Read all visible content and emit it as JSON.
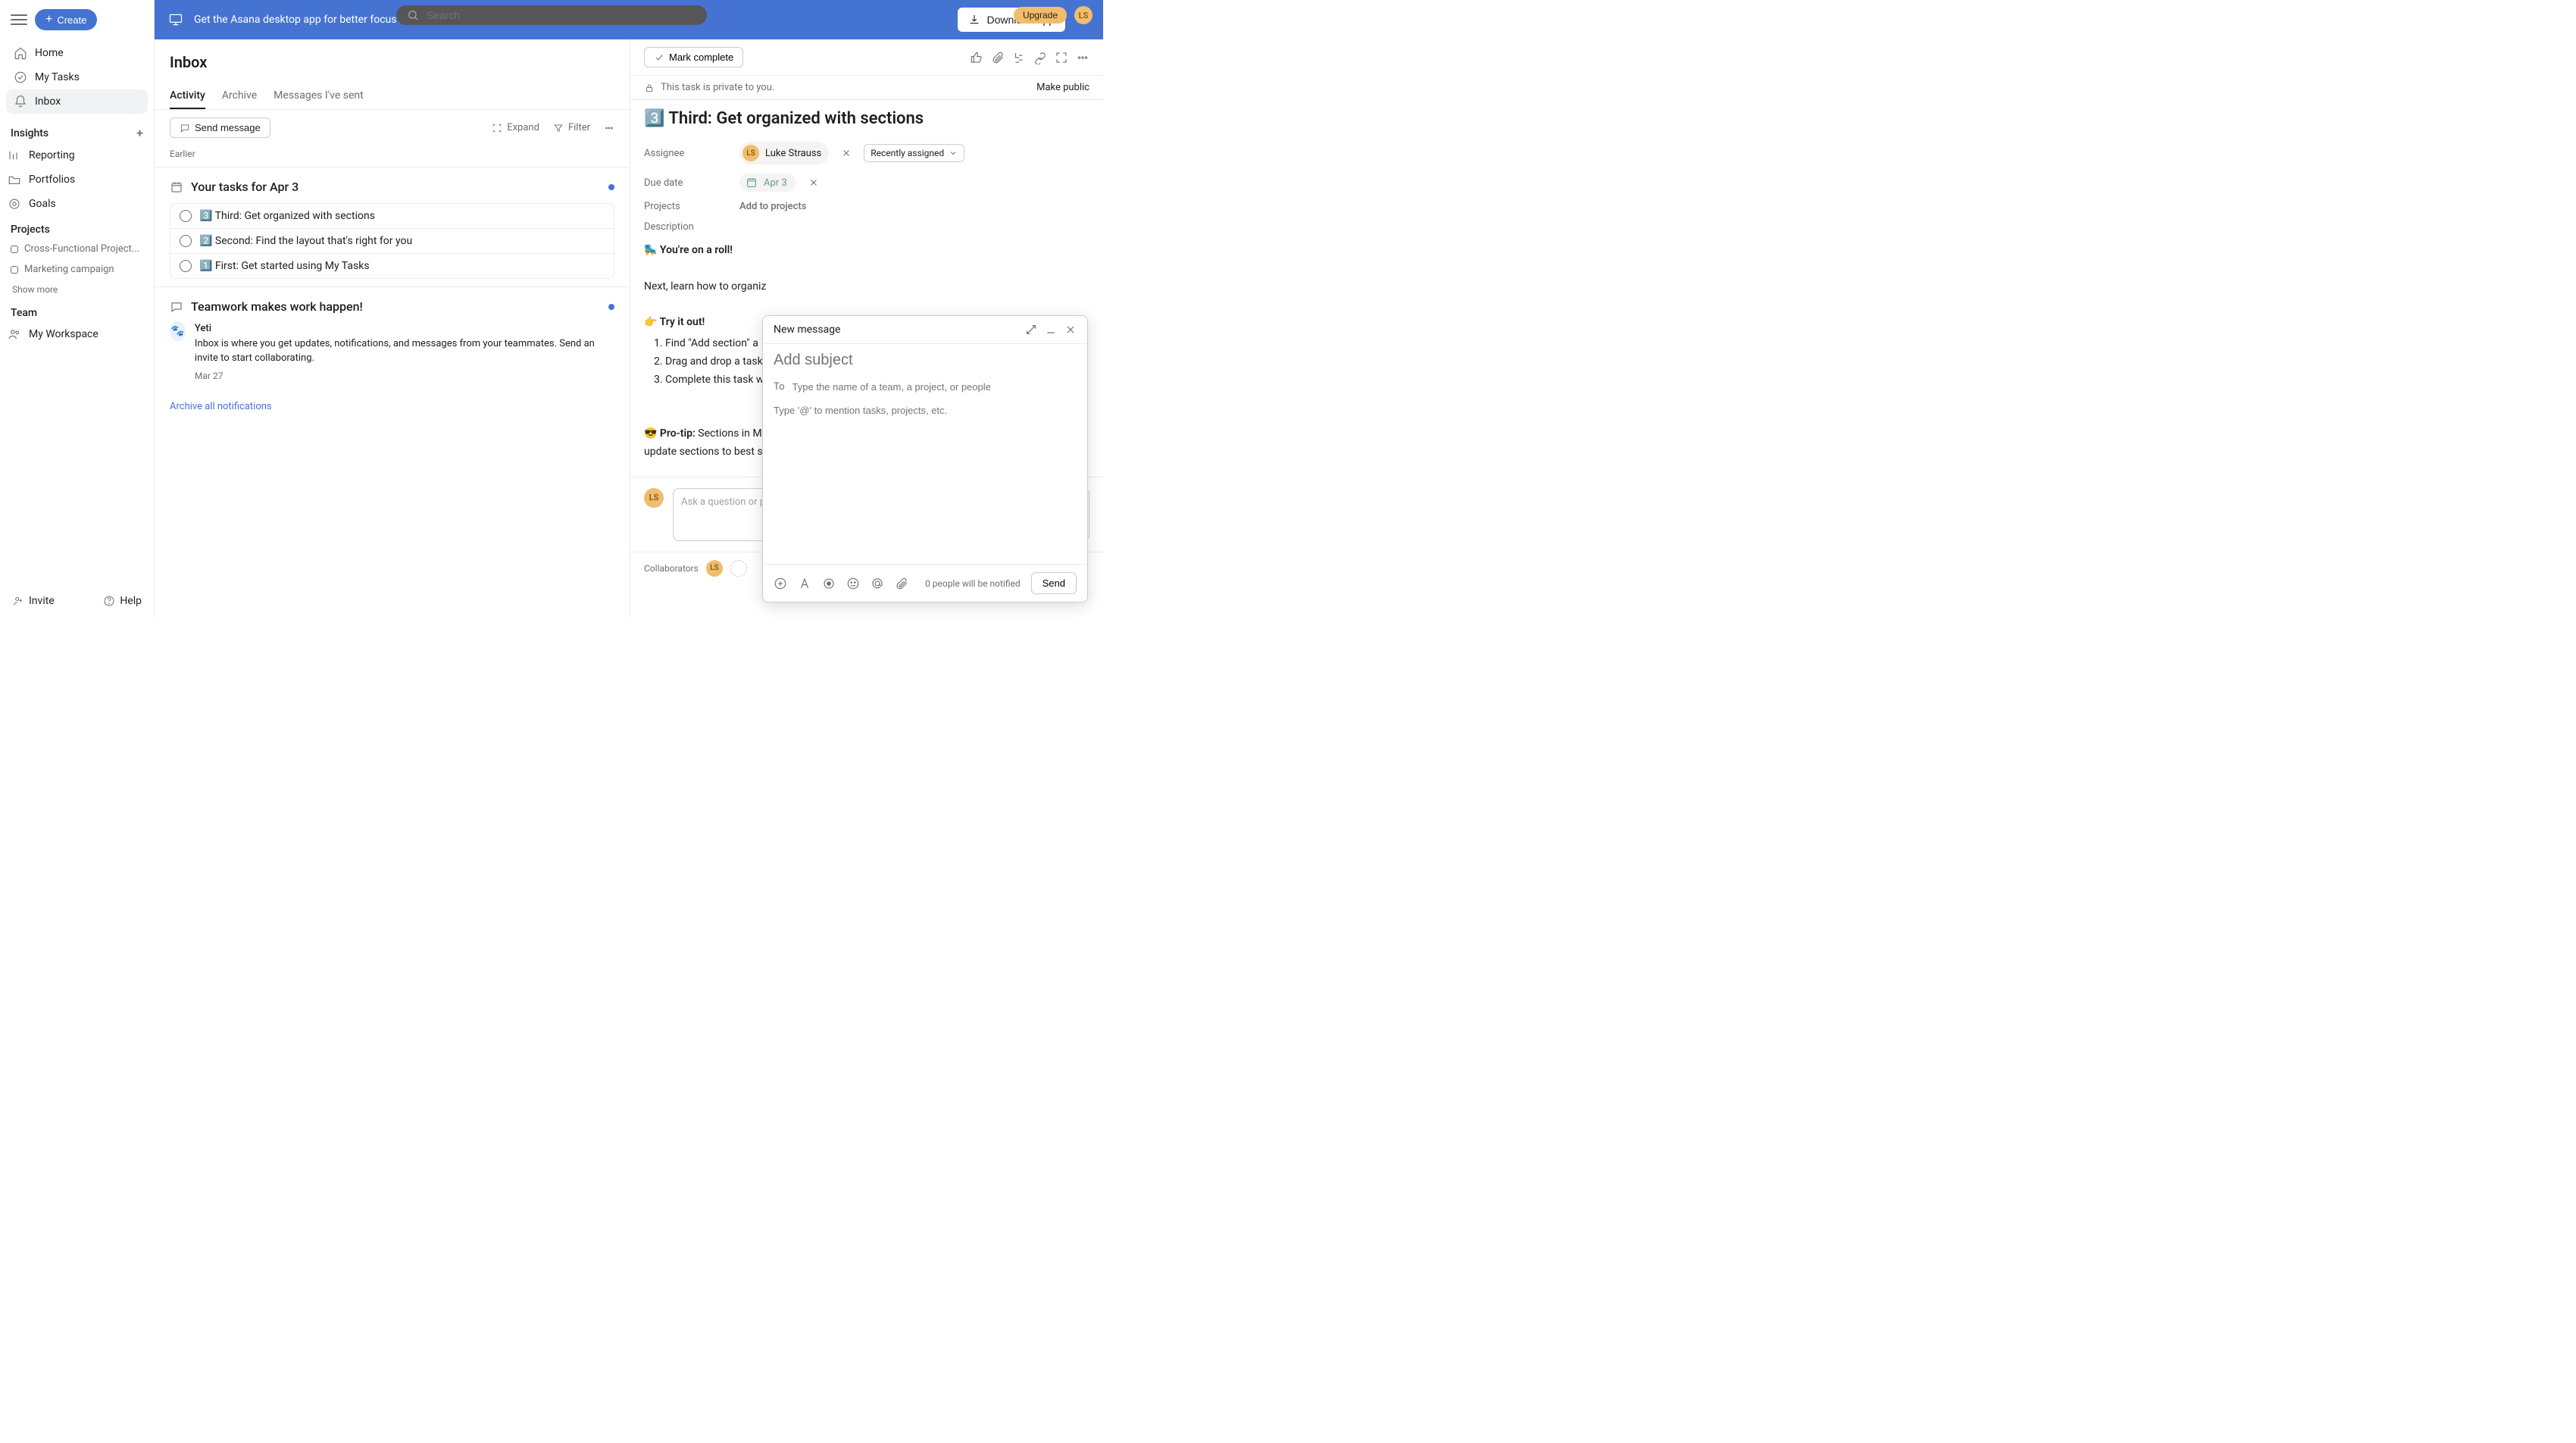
{
  "topbar": {
    "search_placeholder": "Search",
    "upgrade": "Upgrade",
    "avatar": "LS"
  },
  "sidebar": {
    "create": "Create",
    "nav": [
      {
        "label": "Home",
        "icon": "home"
      },
      {
        "label": "My Tasks",
        "icon": "check-circle"
      },
      {
        "label": "Inbox",
        "icon": "bell",
        "active": true
      }
    ],
    "insights": {
      "header": "Insights",
      "items": [
        "Reporting",
        "Portfolios",
        "Goals"
      ]
    },
    "projects": {
      "header": "Projects",
      "items": [
        "Cross-Functional Project...",
        "Marketing campaign"
      ],
      "showmore": "Show more"
    },
    "team": {
      "header": "Team",
      "items": [
        "My Workspace"
      ]
    },
    "invite": "Invite",
    "help": "Help"
  },
  "banner": {
    "text": "Get the Asana desktop app for better focus and productivity.",
    "download": "Download app"
  },
  "inbox": {
    "title": "Inbox",
    "tabs": [
      "Activity",
      "Archive",
      "Messages I've sent"
    ],
    "active_tab": 0,
    "send_message": "Send message",
    "expand": "Expand",
    "filter": "Filter",
    "earlier": "Earlier",
    "group1": {
      "title": "Your tasks for Apr 3",
      "tasks": [
        "3️⃣ Third: Get organized with sections",
        "2️⃣ Second: Find the layout that's right for you",
        "1️⃣ First: Get started using My Tasks"
      ]
    },
    "group2": {
      "title": "Teamwork makes work happen!",
      "author": "Yeti",
      "body": "Inbox is where you get updates, notifications, and messages from your teammates. Send an invite to start collaborating.",
      "date": "Mar 27"
    },
    "archive_all": "Archive all notifications"
  },
  "detail": {
    "mark": "Mark complete",
    "private": "This task is private to you.",
    "make_public": "Make public",
    "title": "3️⃣ Third: Get organized with sections",
    "assignee_label": "Assignee",
    "assignee_name": "Luke Strauss",
    "assignee_initials": "LS",
    "recently": "Recently assigned",
    "due_label": "Due date",
    "due_value": "Apr 3",
    "projects_label": "Projects",
    "add_projects": "Add to projects",
    "description_label": "Description",
    "desc": {
      "roll": "🛼 You're on a roll!",
      "next": "Next, learn how to organiz",
      "try_label": "👉 Try it out!",
      "steps": [
        "Find \"Add section\" a",
        "Drag and drop a task",
        "Complete this task w"
      ],
      "protip_label": "😎 Pro-tip:",
      "protip_body": " Sections in My",
      "protip_line2": "update sections to best su"
    },
    "comment_placeholder": "Ask a question or p",
    "avatar": "LS",
    "collaborators": "Collaborators"
  },
  "popup": {
    "title": "New message",
    "subject_placeholder": "Add subject",
    "to_label": "To",
    "to_placeholder": "Type the name of a team, a project, or people",
    "body_placeholder": "Type '@' to mention tasks, projects, etc.",
    "notify": "0 people will be notified",
    "send": "Send"
  }
}
